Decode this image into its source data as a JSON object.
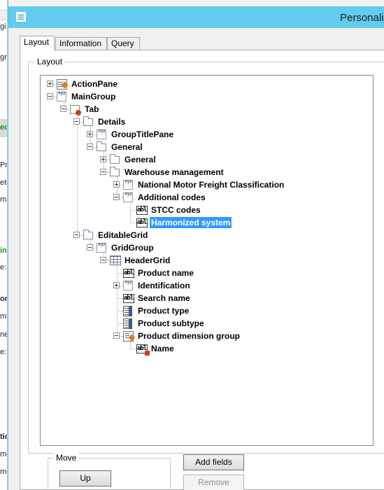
{
  "background_app": {
    "fragments": [
      "gi",
      "gr",
      "ec",
      "Pro",
      "ete",
      "mar",
      "in",
      "e:",
      "on",
      "mb",
      "ne",
      "e:",
      "tio",
      "me",
      "me"
    ]
  },
  "window": {
    "title": "Personaliz"
  },
  "tabs": [
    {
      "label": "Layout",
      "active": true
    },
    {
      "label": "Information",
      "active": false
    },
    {
      "label": "Query",
      "active": false
    }
  ],
  "layout_group": {
    "legend": "Layout"
  },
  "tree": {
    "nodes": [
      {
        "label": "ActionPane",
        "icon": "action-pane-icon",
        "expander": "plus",
        "level": 0
      },
      {
        "label": "MainGroup",
        "icon": "field-group-icon",
        "expander": "minus",
        "level": 0
      },
      {
        "label": "Tab",
        "icon": "tab-icon",
        "expander": "minus",
        "level": 1
      },
      {
        "label": "Details",
        "icon": "folder-icon",
        "expander": "minus",
        "level": 2
      },
      {
        "label": "GroupTitlePane",
        "icon": "field-group-icon",
        "expander": "plus",
        "level": 3
      },
      {
        "label": "General",
        "icon": "folder-icon",
        "expander": "minus",
        "level": 3
      },
      {
        "label": "General",
        "icon": "folder-icon",
        "expander": "plus",
        "level": 4
      },
      {
        "label": "Warehouse management",
        "icon": "folder-icon",
        "expander": "minus",
        "level": 4
      },
      {
        "label": "National Motor Freight Classification",
        "icon": "field-group-icon",
        "expander": "plus",
        "level": 5
      },
      {
        "label": "Additional codes",
        "icon": "field-group-icon",
        "expander": "minus",
        "level": 5
      },
      {
        "label": "STCC codes",
        "icon": "string-field-icon",
        "expander": "none",
        "level": 6
      },
      {
        "label": "Harmonized system",
        "icon": "string-field-icon",
        "expander": "none",
        "level": 6,
        "selected": true
      },
      {
        "label": "EditableGrid",
        "icon": "folder-icon",
        "expander": "minus",
        "level": 2
      },
      {
        "label": "GridGroup",
        "icon": "field-group-icon",
        "expander": "minus",
        "level": 3
      },
      {
        "label": "HeaderGrid",
        "icon": "grid-icon",
        "expander": "minus",
        "level": 4
      },
      {
        "label": "Product name",
        "icon": "string-field-icon",
        "expander": "none",
        "level": 5
      },
      {
        "label": "Identification",
        "icon": "field-group-icon",
        "expander": "plus",
        "level": 5
      },
      {
        "label": "Search name",
        "icon": "string-field-icon",
        "expander": "none",
        "level": 5
      },
      {
        "label": "Product type",
        "icon": "combobox-icon",
        "expander": "none",
        "level": 5
      },
      {
        "label": "Product subtype",
        "icon": "combobox-icon",
        "expander": "none",
        "level": 5
      },
      {
        "label": "Product dimension group",
        "icon": "reference-group-icon",
        "expander": "minus",
        "level": 5
      },
      {
        "label": "Name",
        "icon": "string-field-red-icon",
        "expander": "none",
        "level": 6
      }
    ]
  },
  "move_group": {
    "legend": "Move",
    "up_label": "Up"
  },
  "buttons": {
    "add_fields": "Add fields",
    "remove": "Remove"
  },
  "colors": {
    "titlebar": "#63ccee",
    "selection": "#3399ff"
  }
}
